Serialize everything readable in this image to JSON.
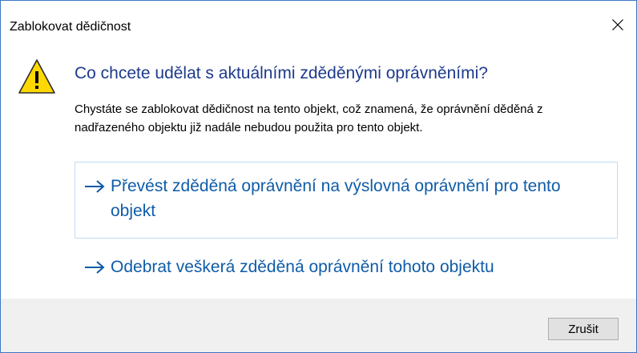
{
  "window": {
    "title": "Zablokovat dědičnost",
    "close_icon": "close-icon"
  },
  "main": {
    "icon": "warning-icon",
    "instruction": "Co chcete udělat s aktuálními zděděnými oprávněními?",
    "content": "Chystáte se zablokovat dědičnost na tento objekt, což znamená, že oprávnění děděná z nadřazeného objektu již nadále nebudou použita pro tento objekt."
  },
  "commands": [
    {
      "label": "Převést zděděná oprávnění na výslovná oprávnění pro tento objekt",
      "icon": "arrow-right-icon"
    },
    {
      "label": "Odebrat veškerá zděděná oprávnění tohoto objektu",
      "icon": "arrow-right-icon"
    }
  ],
  "footer": {
    "cancel_label": "Zrušit"
  },
  "colors": {
    "instruction": "#1e3a8c",
    "command_link": "#0f5ca8",
    "warning_fill": "#ffd800",
    "window_border": "#3c78c4",
    "footer_bg": "#f0f0f0"
  }
}
